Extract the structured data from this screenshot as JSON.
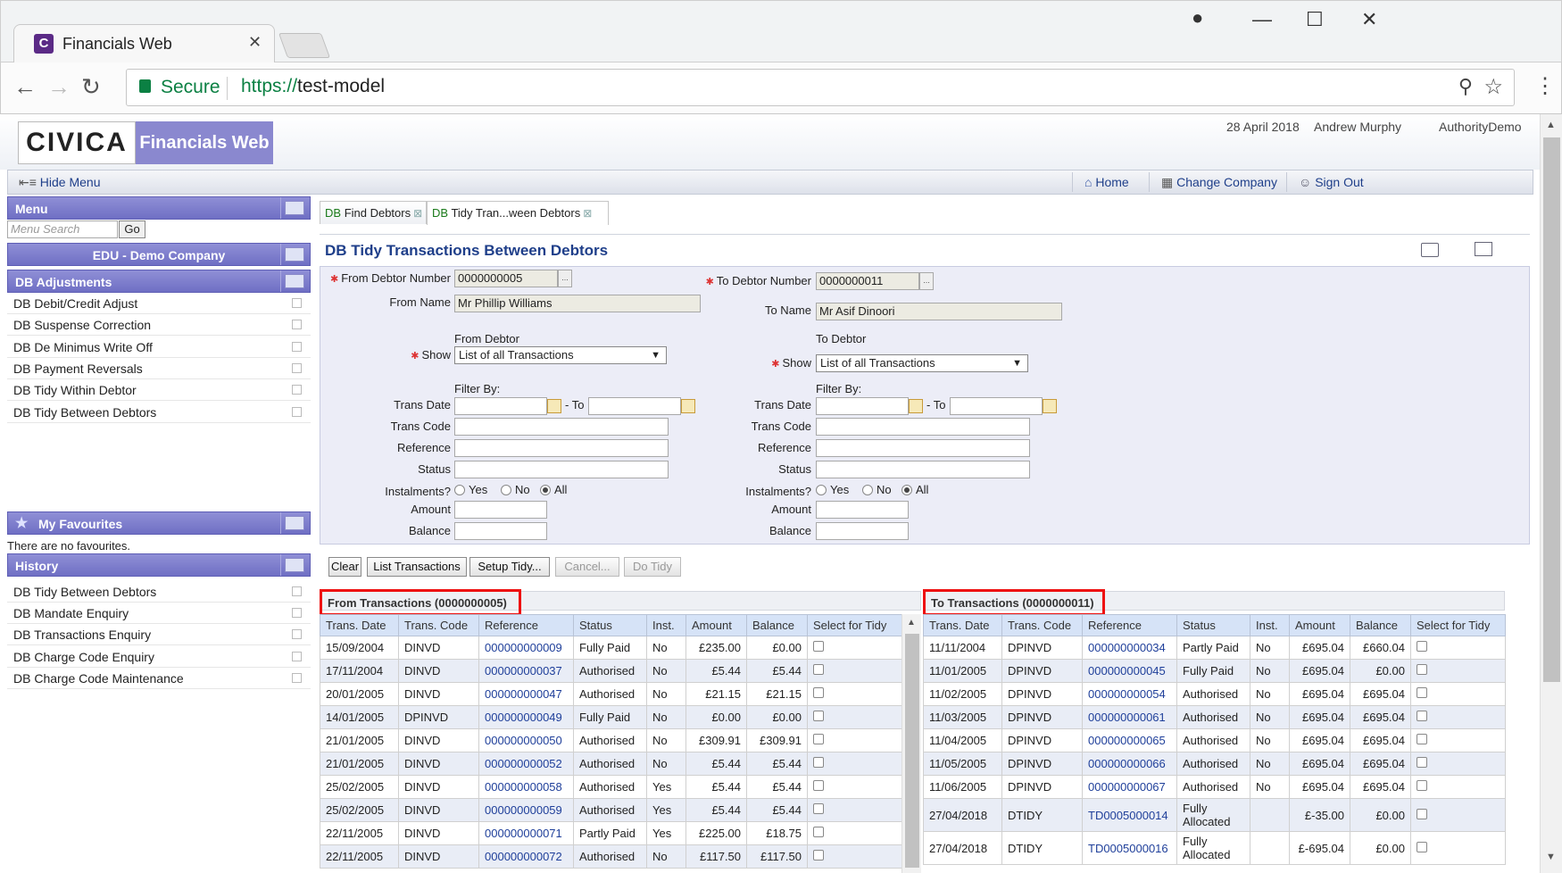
{
  "browser": {
    "tab_title": "Financials Web",
    "favicon_letter": "C",
    "secure_label": "Secure",
    "url_scheme": "https://",
    "url_host": "test-model"
  },
  "header": {
    "logo": "CIVICA",
    "product": "Financials Web",
    "date": "28 April 2018",
    "user": "Andrew Murphy",
    "authority": "AuthorityDemo"
  },
  "toolbar": {
    "hide_menu": "Hide Menu",
    "home": "Home",
    "change_company": "Change Company",
    "sign_out": "Sign Out"
  },
  "sidebar": {
    "menu_title": "Menu",
    "search_placeholder": "Menu Search",
    "go_label": "Go",
    "company": "EDU - Demo Company",
    "section_title": "DB Adjustments",
    "section_items": [
      "DB Debit/Credit Adjust",
      "DB Suspense Correction",
      "DB De Minimus Write Off",
      "DB Payment Reversals",
      "DB Tidy Within Debtor",
      "DB Tidy Between Debtors"
    ],
    "favourites_title": "My Favourites",
    "favourites_empty": "There are no favourites.",
    "history_title": "History",
    "history_items": [
      "DB Tidy Between Debtors",
      "DB Mandate Enquiry",
      "DB Transactions Enquiry",
      "DB Charge Code Enquiry",
      "DB Charge Code Maintenance"
    ]
  },
  "tabs": [
    {
      "prefix": "DB",
      "label": "Find Debtors"
    },
    {
      "prefix": "DB",
      "label": "Tidy Tran...ween Debtors"
    }
  ],
  "page": {
    "title": "DB Tidy Transactions Between Debtors"
  },
  "form": {
    "from_debtor_number_label": "From Debtor Number",
    "from_debtor_number": "0000000005",
    "from_name_label": "From Name",
    "from_name": "Mr  Phillip  Williams",
    "to_debtor_number_label": "To Debtor Number",
    "to_debtor_number": "0000000011",
    "to_name_label": "To Name",
    "to_name": "Mr Asif Dinoori",
    "from_debtor_heading": "From Debtor",
    "to_debtor_heading": "To Debtor",
    "show_label": "Show",
    "show_value": "List of all Transactions",
    "filter_by": "Filter By:",
    "trans_date": "Trans Date",
    "to_label": "- To",
    "trans_code": "Trans Code",
    "reference": "Reference",
    "status": "Status",
    "instalments": "Instalments?",
    "yes": "Yes",
    "no": "No",
    "all": "All",
    "amount": "Amount",
    "balance": "Balance"
  },
  "buttons": {
    "clear": "Clear",
    "list_transactions": "List Transactions",
    "setup_tidy": "Setup Tidy...",
    "cancel": "Cancel...",
    "do_tidy": "Do Tidy"
  },
  "from_table": {
    "caption": "From Transactions (0000000005)",
    "columns": [
      "Trans. Date",
      "Trans. Code",
      "Reference",
      "Status",
      "Inst.",
      "Amount",
      "Balance",
      "Select for Tidy"
    ],
    "rows": [
      [
        "15/09/2004",
        "DINVD",
        "000000000009",
        "Fully Paid",
        "No",
        "£235.00",
        "£0.00"
      ],
      [
        "17/11/2004",
        "DINVD",
        "000000000037",
        "Authorised",
        "No",
        "£5.44",
        "£5.44"
      ],
      [
        "20/01/2005",
        "DINVD",
        "000000000047",
        "Authorised",
        "No",
        "£21.15",
        "£21.15"
      ],
      [
        "14/01/2005",
        "DPINVD",
        "000000000049",
        "Fully Paid",
        "No",
        "£0.00",
        "£0.00"
      ],
      [
        "21/01/2005",
        "DINVD",
        "000000000050",
        "Authorised",
        "No",
        "£309.91",
        "£309.91"
      ],
      [
        "21/01/2005",
        "DINVD",
        "000000000052",
        "Authorised",
        "No",
        "£5.44",
        "£5.44"
      ],
      [
        "25/02/2005",
        "DINVD",
        "000000000058",
        "Authorised",
        "Yes",
        "£5.44",
        "£5.44"
      ],
      [
        "25/02/2005",
        "DINVD",
        "000000000059",
        "Authorised",
        "Yes",
        "£5.44",
        "£5.44"
      ],
      [
        "22/11/2005",
        "DINVD",
        "000000000071",
        "Partly Paid",
        "Yes",
        "£225.00",
        "£18.75"
      ],
      [
        "22/11/2005",
        "DINVD",
        "000000000072",
        "Authorised",
        "No",
        "£117.50",
        "£117.50"
      ]
    ]
  },
  "to_table": {
    "caption": "To Transactions (0000000011)",
    "columns": [
      "Trans. Date",
      "Trans. Code",
      "Reference",
      "Status",
      "Inst.",
      "Amount",
      "Balance",
      "Select for Tidy"
    ],
    "rows": [
      [
        "11/11/2004",
        "DPINVD",
        "000000000034",
        "Partly Paid",
        "No",
        "£695.04",
        "£660.04"
      ],
      [
        "11/01/2005",
        "DPINVD",
        "000000000045",
        "Fully Paid",
        "No",
        "£695.04",
        "£0.00"
      ],
      [
        "11/02/2005",
        "DPINVD",
        "000000000054",
        "Authorised",
        "No",
        "£695.04",
        "£695.04"
      ],
      [
        "11/03/2005",
        "DPINVD",
        "000000000061",
        "Authorised",
        "No",
        "£695.04",
        "£695.04"
      ],
      [
        "11/04/2005",
        "DPINVD",
        "000000000065",
        "Authorised",
        "No",
        "£695.04",
        "£695.04"
      ],
      [
        "11/05/2005",
        "DPINVD",
        "000000000066",
        "Authorised",
        "No",
        "£695.04",
        "£695.04"
      ],
      [
        "11/06/2005",
        "DPINVD",
        "000000000067",
        "Authorised",
        "No",
        "£695.04",
        "£695.04"
      ],
      [
        "27/04/2018",
        "DTIDY",
        "TD0005000014",
        "Fully Allocated",
        "",
        "£-35.00",
        "£0.00"
      ],
      [
        "27/04/2018",
        "DTIDY",
        "TD0005000016",
        "Fully Allocated",
        "",
        "£-695.04",
        "£0.00"
      ]
    ]
  }
}
